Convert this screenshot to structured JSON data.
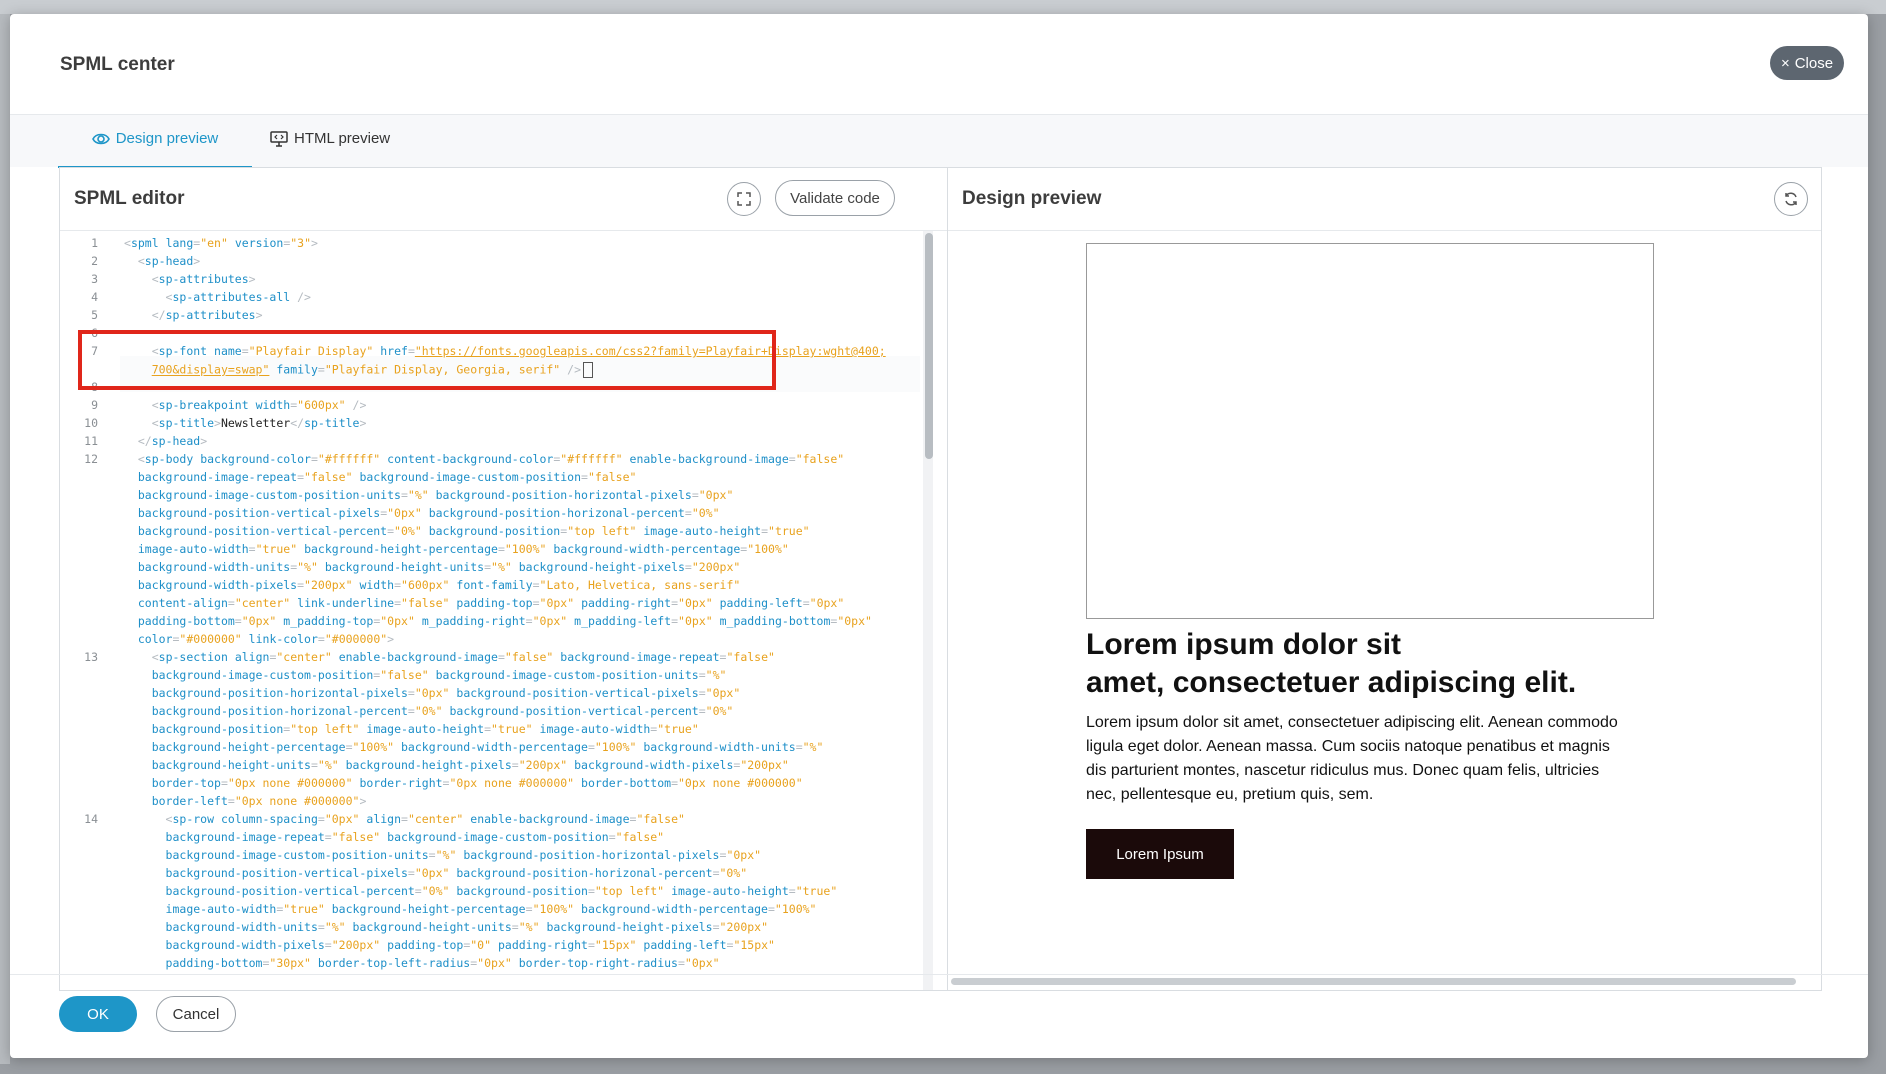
{
  "modal": {
    "title": "SPML center",
    "close_label": "Close"
  },
  "tabs": [
    {
      "label": "Design preview",
      "icon": "eye-icon",
      "active": true
    },
    {
      "label": "HTML preview",
      "icon": "monitor-code-icon",
      "active": false
    }
  ],
  "editor": {
    "title": "SPML editor",
    "validate_label": "Validate code",
    "expand_icon": "expand-icon",
    "line_numbers": [
      "1",
      "2",
      "3",
      "4",
      "5",
      "6",
      "7",
      "8",
      "9",
      "10",
      "11",
      "12",
      "13",
      "14"
    ]
  },
  "preview": {
    "title": "Design preview",
    "refresh_icon": "refresh-icon",
    "headline_line1": "Lorem ipsum dolor sit",
    "headline_line2": "amet, consectetuer adipiscing elit.",
    "body": "Lorem ipsum dolor sit amet, consectetuer adipiscing elit. Aenean commodo ligula eget dolor. Aenean massa. Cum sociis natoque penatibus et magnis dis parturient montes, nascetur ridiculus mus. Donec quam felis, ultricies nec, pellentesque eu, pretium quis, sem.",
    "button_label": "Lorem Ipsum"
  },
  "footer": {
    "ok_label": "OK",
    "cancel_label": "Cancel"
  },
  "colors": {
    "accent": "#1e96c8",
    "highlight": "#e0261a",
    "close_bg": "#5d6670",
    "cta_bg": "#1b0a0a"
  }
}
